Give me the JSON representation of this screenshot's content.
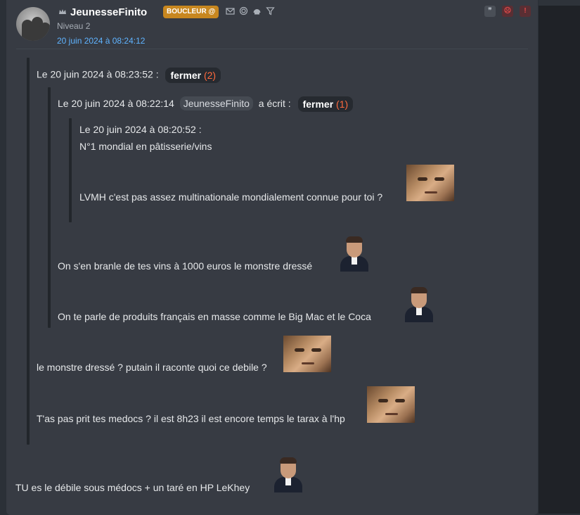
{
  "header": {
    "username": "JeunesseFinito",
    "badge": "BOUCLEUR",
    "badge_icon": "@",
    "level": "Niveau 2",
    "date": "20 juin 2024 à 08:24:12",
    "icons": [
      "crown-icon",
      "mail-icon",
      "target-icon",
      "helmet-icon",
      "filter-icon"
    ],
    "actions": [
      "quote-icon",
      "sad-face-icon",
      "alert-icon"
    ]
  },
  "quote1": {
    "date_text": "Le 20 juin 2024 à 08:23:52 :",
    "toggle_label": "fermer",
    "toggle_count": "(2)",
    "quote2": {
      "date_text": "Le 20 juin 2024 à 08:22:14",
      "author": "JeunesseFinito",
      "wrote": "a écrit :",
      "toggle_label": "fermer",
      "toggle_count": "(1)",
      "quote3": {
        "date_text": "Le 20 juin 2024 à 08:20:52 :",
        "line1": "N°1 mondial en pâtisserie/vins",
        "line2": "LVMH c'est pas assez multinationale mondialement connue pour toi ?"
      },
      "line1": "On s'en branle de tes vins à 1000 euros le monstre dressé",
      "line2": "On te parle de produits français en masse comme le Big Mac et le Coca"
    },
    "line1": "le monstre dressé ? putain il raconte quoi ce debile ?",
    "line2": "T'as pas prit tes medocs ? il est 8h23 il est encore temps le tarax à l'hp"
  },
  "body": {
    "line": "TU es le débile sous médocs + un taré en HP LeKhey"
  },
  "colors": {
    "background": "#2b3037",
    "post": "#373b43",
    "badge": "#c8871f",
    "date_link": "#5fb3ff",
    "count": "#ff6a3d"
  }
}
